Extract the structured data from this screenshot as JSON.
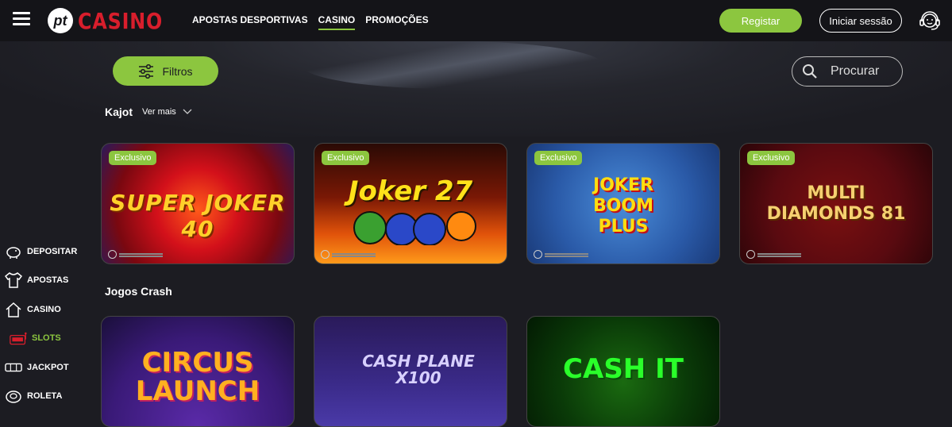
{
  "header": {
    "logo_pt": "pt",
    "logo_casino": "CASINO",
    "nav": [
      {
        "label": "APOSTAS DESPORTIVAS",
        "active": false
      },
      {
        "label": "CASINO",
        "active": true
      },
      {
        "label": "PROMOÇÕES",
        "active": false
      }
    ],
    "register_label": "Registar",
    "login_label": "Iniciar sessão"
  },
  "toolbar": {
    "filter_label": "Filtros",
    "search_placeholder": "Procurar"
  },
  "sections": [
    {
      "title": "Kajot",
      "see_more": "Ver mais",
      "games": [
        {
          "title": "SUPER JOKER 40",
          "badge": "Exclusivo"
        },
        {
          "title": "Joker 27",
          "badge": "Exclusivo"
        },
        {
          "title": "JOKER BOOM PLUS",
          "badge": "Exclusivo"
        },
        {
          "title": "MULTI DIAMONDS 81",
          "badge": "Exclusivo"
        }
      ]
    },
    {
      "title": "Jogos Crash",
      "games": [
        {
          "title": "CIRCUS LAUNCH"
        },
        {
          "title": "CASH PLANE X100"
        },
        {
          "title": "CASH IT"
        }
      ]
    }
  ],
  "sidebar": {
    "items": [
      {
        "label": "DEPOSITAR",
        "icon": "piggy-bank-icon",
        "active": false
      },
      {
        "label": "APOSTAS",
        "icon": "jersey-icon",
        "active": false
      },
      {
        "label": "CASINO",
        "icon": "house-icon",
        "active": false
      },
      {
        "label": "SLOTS",
        "icon": "slot-machine-icon",
        "active": true
      },
      {
        "label": "JACKPOT",
        "icon": "jackpot-icon",
        "active": false
      },
      {
        "label": "ROLETA",
        "icon": "roulette-icon",
        "active": false
      }
    ]
  },
  "colors": {
    "accent": "#8cc63f",
    "brand_red": "#d81e2c",
    "background": "#1c1c22"
  }
}
